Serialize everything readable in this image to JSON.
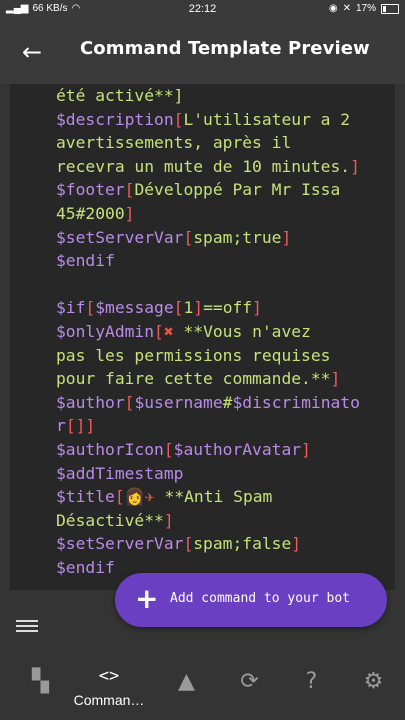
{
  "status_bar": {
    "network": "66 KB/s",
    "time": "22:12",
    "battery": "17%"
  },
  "app_bar": {
    "title": "Command Template Preview",
    "back_icon": "arrow-back-icon"
  },
  "code_lines": [
    [
      {
        "t": "tx",
        "v": "été activé**]"
      }
    ],
    [
      {
        "t": "fn",
        "v": "$description"
      },
      {
        "t": "br",
        "v": "["
      },
      {
        "t": "tx",
        "v": "L'utilisateur a 2"
      }
    ],
    [
      {
        "t": "tx",
        "v": "avertissements, après il"
      }
    ],
    [
      {
        "t": "tx",
        "v": "recevra un mute de 10 minutes."
      },
      {
        "t": "br",
        "v": "]"
      }
    ],
    [
      {
        "t": "fn",
        "v": "$footer"
      },
      {
        "t": "br",
        "v": "["
      },
      {
        "t": "tx",
        "v": "Développé Par Mr Issa"
      }
    ],
    [
      {
        "t": "tx",
        "v": "45#2000"
      },
      {
        "t": "br",
        "v": "]"
      }
    ],
    [
      {
        "t": "fn",
        "v": "$setServerVar"
      },
      {
        "t": "br",
        "v": "["
      },
      {
        "t": "tx",
        "v": "spam;true"
      },
      {
        "t": "br",
        "v": "]"
      }
    ],
    [
      {
        "t": "fn",
        "v": "$endif"
      }
    ],
    [],
    [
      {
        "t": "fn",
        "v": "$if"
      },
      {
        "t": "br",
        "v": "["
      },
      {
        "t": "fn",
        "v": "$message"
      },
      {
        "t": "br",
        "v": "["
      },
      {
        "t": "tx",
        "v": "1"
      },
      {
        "t": "br",
        "v": "]"
      },
      {
        "t": "tx",
        "v": "==off"
      },
      {
        "t": "br",
        "v": "]"
      }
    ],
    [
      {
        "t": "fn",
        "v": "$onlyAdmin"
      },
      {
        "t": "br",
        "v": "["
      },
      {
        "t": "emo",
        "v": "✖"
      },
      {
        "t": "tx",
        "v": " **Vous n'avez"
      }
    ],
    [
      {
        "t": "tx",
        "v": "pas les permissions requises"
      }
    ],
    [
      {
        "t": "tx",
        "v": "pour faire cette commande.**"
      },
      {
        "t": "br",
        "v": "]"
      }
    ],
    [
      {
        "t": "fn",
        "v": "$author"
      },
      {
        "t": "br",
        "v": "["
      },
      {
        "t": "fn",
        "v": "$username"
      },
      {
        "t": "tx",
        "v": "#"
      },
      {
        "t": "fn",
        "v": "$discriminato"
      }
    ],
    [
      {
        "t": "fn",
        "v": "r"
      },
      {
        "t": "br",
        "v": "[]]"
      }
    ],
    [
      {
        "t": "fn",
        "v": "$authorIcon"
      },
      {
        "t": "br",
        "v": "["
      },
      {
        "t": "fn",
        "v": "$authorAvatar"
      },
      {
        "t": "br",
        "v": "]"
      }
    ],
    [
      {
        "t": "fn",
        "v": "$addTimestamp"
      }
    ],
    [
      {
        "t": "fn",
        "v": "$title"
      },
      {
        "t": "br",
        "v": "["
      },
      {
        "t": "emo",
        "v": "👩✈"
      },
      {
        "t": "tx",
        "v": " **Anti Spam"
      }
    ],
    [
      {
        "t": "tx",
        "v": "Désactivé**"
      },
      {
        "t": "br",
        "v": "]"
      }
    ],
    [
      {
        "t": "fn",
        "v": "$setServerVar"
      },
      {
        "t": "br",
        "v": "["
      },
      {
        "t": "tx",
        "v": "spam;false"
      },
      {
        "t": "br",
        "v": "]"
      }
    ],
    [
      {
        "t": "fn",
        "v": "$endif"
      }
    ]
  ],
  "fab": {
    "label": "Add command to your bot",
    "icon": "plus-icon"
  },
  "bottom_nav": [
    {
      "icon": "dashboard-icon",
      "glyph": "▚",
      "label": ""
    },
    {
      "icon": "code-icon",
      "glyph": "<>",
      "label": "Comman…"
    },
    {
      "icon": "shapes-icon",
      "glyph": "▲",
      "label": ""
    },
    {
      "icon": "sync-icon",
      "glyph": "⟳",
      "label": ""
    },
    {
      "icon": "help-icon",
      "glyph": "?",
      "label": ""
    },
    {
      "icon": "settings-icon",
      "glyph": "⚙",
      "label": ""
    }
  ],
  "colors": {
    "function": "#b98be8",
    "bracket": "#f05a5a",
    "text": "#c8e07a",
    "fab": "#6a3fc2"
  }
}
